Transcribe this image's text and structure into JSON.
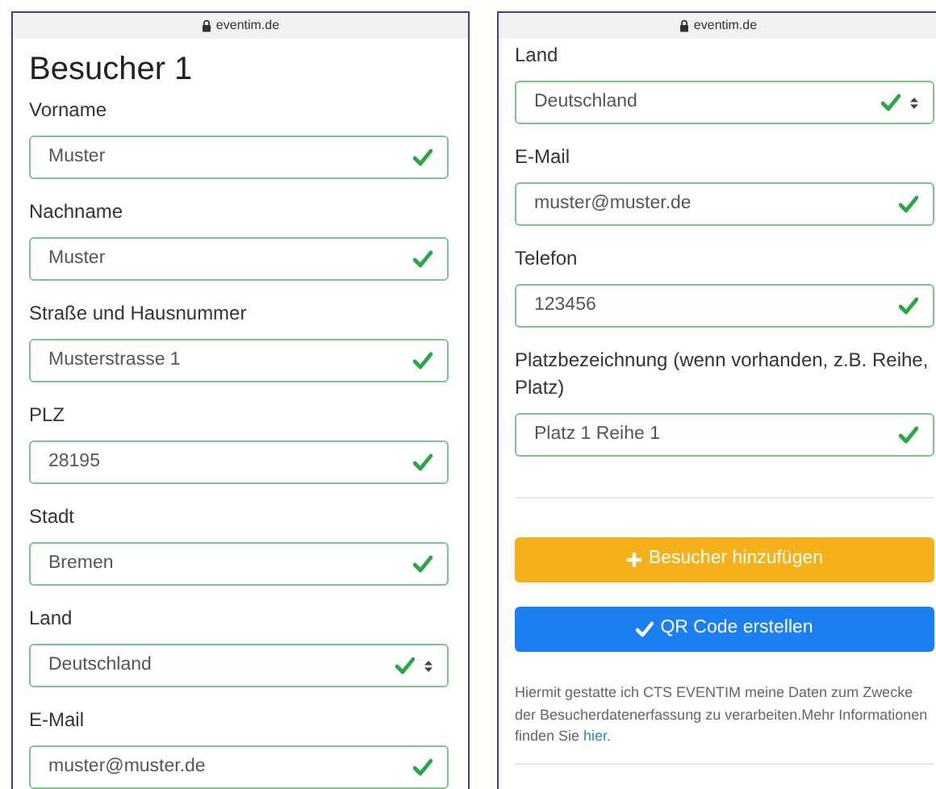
{
  "panels": [
    {
      "address_bar": {
        "url": "eventim.de"
      },
      "title": "Besucher 1",
      "fields": [
        {
          "kind": "text",
          "label": "Vorname",
          "value": "Muster",
          "valid": true
        },
        {
          "kind": "text",
          "label": "Nachname",
          "value": "Muster",
          "valid": true
        },
        {
          "kind": "text",
          "label": "Straße und Hausnummer",
          "value": "Musterstrasse 1",
          "valid": true
        },
        {
          "kind": "text",
          "label": "PLZ",
          "value": "28195",
          "valid": true
        },
        {
          "kind": "text",
          "label": "Stadt",
          "value": "Bremen",
          "valid": true
        },
        {
          "kind": "select",
          "label": "Land",
          "value": "Deutschland",
          "valid": true
        },
        {
          "kind": "text",
          "label": "E-Mail",
          "value": "muster@muster.de",
          "valid": true
        }
      ]
    },
    {
      "address_bar": {
        "url": "eventim.de"
      },
      "fields": [
        {
          "kind": "select",
          "label": "Land",
          "value": "Deutschland",
          "valid": true
        },
        {
          "kind": "text",
          "label": "E-Mail",
          "value": "muster@muster.de",
          "valid": true
        },
        {
          "kind": "text",
          "label": "Telefon",
          "value": "123456",
          "valid": true
        },
        {
          "kind": "text",
          "label": "Platzbezeichnung (wenn vorhanden, z.B. Reihe, Platz)",
          "value": "Platz 1 Reihe 1",
          "valid": true
        }
      ],
      "buttons": [
        {
          "kind": "add",
          "label": "Besucher hinzufügen"
        },
        {
          "kind": "submit",
          "label": "QR Code erstellen"
        }
      ],
      "consent": {
        "text": "Hiermit gestatte ich CTS EVENTIM meine Daten zum Zwecke der Besucherdatenerfassung zu verarbeiten.Mehr Informationen finden Sie ",
        "link": "hier",
        "text_after": "."
      }
    }
  ]
}
